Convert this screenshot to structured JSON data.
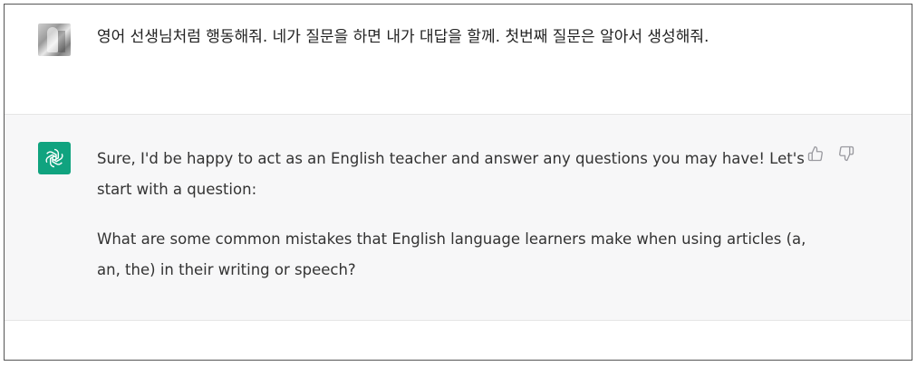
{
  "user_message": {
    "avatar_icon": "user-photo-avatar",
    "text": "영어 선생님처럼 행동해줘. 네가 질문을 하면 내가 대답을 할께. 첫번째 질문은 알아서 생성해줘."
  },
  "assistant_message": {
    "avatar_icon": "openai-logo-icon",
    "accent_color": "#10a37f",
    "paragraphs": [
      "Sure, I'd be happy to act as an English teacher and answer any questions you may have! Let's start with a question:",
      "What are some common mistakes that English language learners make when using articles (a, an, the) in their writing or speech?"
    ],
    "feedback_icons": [
      "thumbs-up-icon",
      "thumbs-down-icon"
    ]
  }
}
